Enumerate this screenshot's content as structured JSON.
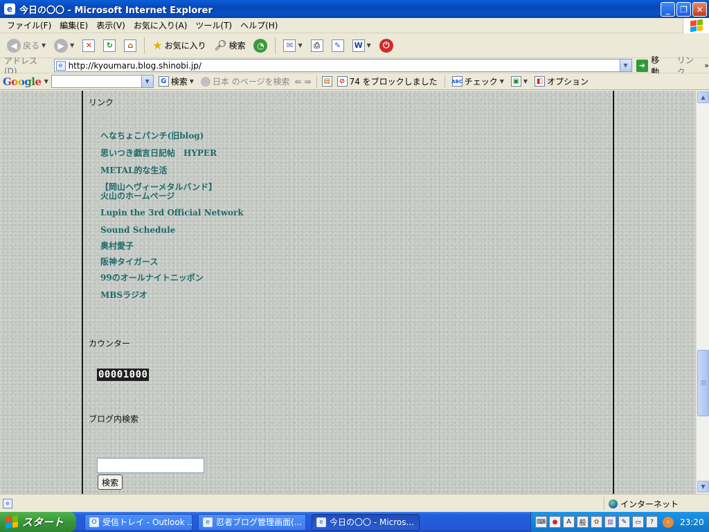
{
  "window": {
    "title": "今日の〇〇 - Microsoft Internet Explorer",
    "minimize": "_",
    "maximize": "❐",
    "close": "✕"
  },
  "menu": [
    "ファイル(F)",
    "編集(E)",
    "表示(V)",
    "お気に入り(A)",
    "ツール(T)",
    "ヘルプ(H)"
  ],
  "toolbar": {
    "back": "戻る",
    "favorites": "お気に入り",
    "search": "検索"
  },
  "address": {
    "label": "アドレス(D)",
    "url": "http://kyoumaru.blog.shinobi.jp/",
    "go": "移動",
    "links": "リンク",
    "chevron": "»"
  },
  "google": {
    "logo": "Google",
    "search": "検索",
    "page_search": "日本 のページを検索",
    "blocked": "74 をブロックしました",
    "check": "チェック",
    "options": "オプション"
  },
  "sidebar": {
    "links_title": "リンク",
    "links": [
      "へなちょこパンチ(旧blog)",
      "思いつき戯言日記帖　HYPER",
      "METAL的な生活",
      "【岡山ヘヴィーメタルバンド】火山のホームページ",
      "Lupin the 3rd Official Network",
      "Sound Schedule",
      "奥村愛子",
      "阪神タイガース",
      "99のオールナイトニッポン",
      "MBSラジオ"
    ],
    "counter_title": "カウンター",
    "counter_value": "00001000",
    "search_title": "ブログ内検索",
    "search_button": "検索"
  },
  "statusbar": {
    "zone": "インターネット"
  },
  "taskbar": {
    "start": "スタート",
    "tasks": [
      "受信トレイ - Outlook ...",
      "忍者ブログ管理画面(...",
      "今日の〇〇 - Micros..."
    ],
    "ime_label": "般",
    "clock": "23:20"
  },
  "colors": {
    "link": "#1c6b6b",
    "background": "#c9cdc8",
    "titlebar": "#0a4fc4",
    "taskbar": "#245edb"
  }
}
